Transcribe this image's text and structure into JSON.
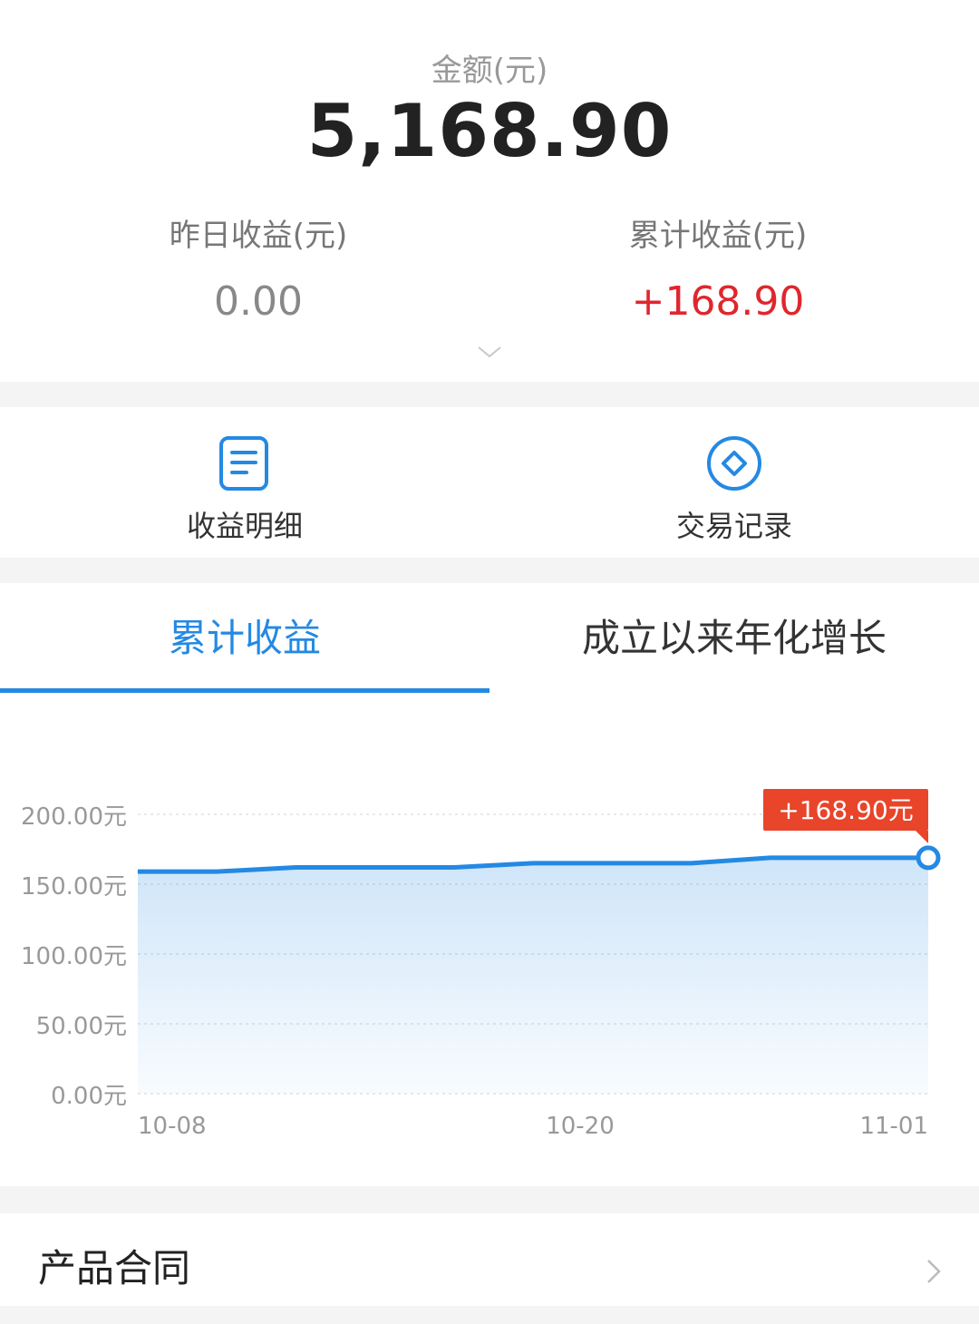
{
  "summary": {
    "amount_label": "金额(元)",
    "amount_value": "5,168.90",
    "yesterday_label": "昨日收益(元)",
    "yesterday_value": "0.00",
    "total_label": "累计收益(元)",
    "total_value": "+168.90",
    "expand_icon": "chevron-down-icon"
  },
  "actions": [
    {
      "label": "收益明细",
      "icon": "document-icon"
    },
    {
      "label": "交易记录",
      "icon": "diamond-circle-icon"
    }
  ],
  "tabs": [
    {
      "label": "累计收益",
      "active": true
    },
    {
      "label": "成立以来年化增长",
      "active": false
    }
  ],
  "contract": {
    "label": "产品合同",
    "icon": "chevron-right-icon"
  },
  "colors": {
    "accent": "#2489e3",
    "positive": "#e0262d",
    "tooltip_bg": "#e8452b"
  },
  "chart_data": {
    "type": "area",
    "y_ticks": [
      "200.00元",
      "150.00元",
      "100.00元",
      "50.00元",
      "0.00元"
    ],
    "ylim": [
      0,
      200
    ],
    "x_tick_labels": [
      "10-08",
      "10-20",
      "11-01"
    ],
    "x": [
      "10-08",
      "10-11",
      "10-13",
      "10-15",
      "10-18",
      "10-20",
      "10-22",
      "10-25",
      "10-27",
      "10-29",
      "11-01"
    ],
    "values": [
      159,
      159,
      162,
      162,
      162,
      165,
      165,
      165,
      168.9,
      168.9,
      168.9
    ],
    "tooltip": "+168.90元",
    "grid": true
  }
}
